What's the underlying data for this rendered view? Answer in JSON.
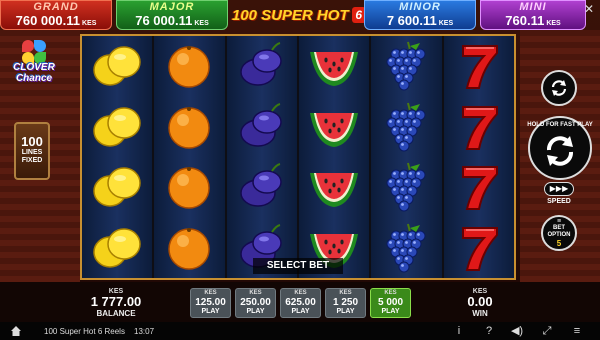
{
  "jackpots": {
    "grand": {
      "name": "GRAND",
      "value": "760 000.11",
      "currency": "KES"
    },
    "major": {
      "name": "MAJOR",
      "value": "76 000.11",
      "currency": "KES"
    },
    "minor": {
      "name": "MINOR",
      "value": "7 600.11",
      "currency": "KES"
    },
    "mini": {
      "name": "MINI",
      "value": "760.11",
      "currency": "KES"
    }
  },
  "game_logo": {
    "text": "100 SUPER HOT",
    "badge": "6"
  },
  "clover_logo": {
    "line1": "CLOVER",
    "line2": "Chance"
  },
  "lines": {
    "count": "100",
    "label": "LINES FIXED"
  },
  "reels": [
    [
      "lemon",
      "lemon",
      "lemon",
      "lemon"
    ],
    [
      "orange",
      "orange",
      "orange",
      "orange"
    ],
    [
      "plum",
      "plum",
      "plum",
      "plum"
    ],
    [
      "watermelon",
      "watermelon",
      "watermelon",
      "watermelon"
    ],
    [
      "grapes",
      "grapes",
      "grapes",
      "grapes"
    ],
    [
      "seven",
      "seven",
      "seven",
      "seven"
    ]
  ],
  "select_bet_label": "SELECT BET",
  "controls": {
    "hold_text": "HOLD FOR FAST PLAY",
    "speed_label": "SPEED",
    "speed_icon": "fast-forward-icon",
    "bet_option_label": "BET OPTION",
    "bet_option_value": "5"
  },
  "balance": {
    "currency": "KES",
    "amount": "1 777.00",
    "label": "BALANCE"
  },
  "win": {
    "currency": "KES",
    "amount": "0.00",
    "label": "WIN"
  },
  "bets": [
    {
      "currency": "KES",
      "amount": "125.00",
      "label": "PLAY",
      "active": false
    },
    {
      "currency": "KES",
      "amount": "250.00",
      "label": "PLAY",
      "active": false
    },
    {
      "currency": "KES",
      "amount": "625.00",
      "label": "PLAY",
      "active": false
    },
    {
      "currency": "KES",
      "amount": "1 250",
      "label": "PLAY",
      "active": false
    },
    {
      "currency": "KES",
      "amount": "5 000",
      "label": "PLAY",
      "active": true
    }
  ],
  "footer": {
    "game_name": "100 Super Hot 6 Reels",
    "time": "13:07"
  },
  "colors": {
    "accent_gold": "#c89030",
    "active_bet": "#3a8a1a"
  }
}
